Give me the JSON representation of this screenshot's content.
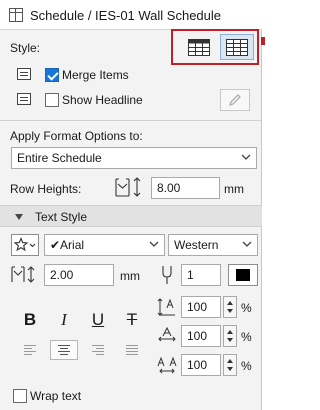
{
  "window": {
    "title": "Schedule / IES-01  Wall Schedule"
  },
  "style": {
    "label": "Style:",
    "merge_items": {
      "label": "Merge Items",
      "checked": true
    },
    "show_headline": {
      "label": "Show Headline",
      "checked": false
    }
  },
  "format_options": {
    "label": "Apply Format Options to:",
    "selected": "Entire Schedule"
  },
  "row_heights": {
    "label": "Row Heights:",
    "value": "8.00",
    "unit": "mm"
  },
  "text_style": {
    "header": "Text Style",
    "font": "✔Arial",
    "script": "Western",
    "size": {
      "value": "2.00",
      "unit": "mm"
    },
    "pen": "1",
    "format_buttons": [
      "B",
      "I",
      "U",
      "T"
    ],
    "spacing_rows": [
      {
        "value": "100",
        "unit": "%"
      },
      {
        "value": "100",
        "unit": "%"
      },
      {
        "value": "100",
        "unit": "%"
      }
    ]
  },
  "wrap_text": {
    "label": "Wrap text",
    "checked": false
  },
  "colors": {
    "accent": "#1877d6",
    "highlight": "#c0202a",
    "panel": "#f3f3f3"
  }
}
